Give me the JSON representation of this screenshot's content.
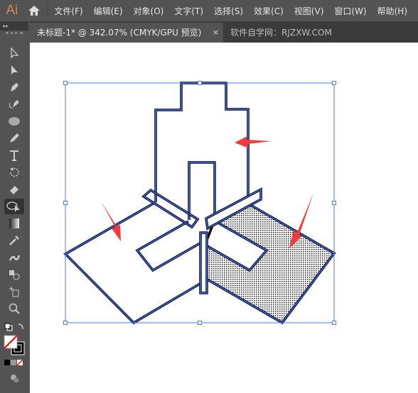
{
  "app": {
    "logo": "Ai",
    "menus": [
      "文件(F)",
      "编辑(E)",
      "对象(O)",
      "文字(T)",
      "选择(S)",
      "效果(C)",
      "视图(V)",
      "窗口(W)",
      "帮助(H)"
    ]
  },
  "tabs": {
    "active": "未标题-1* @ 342.07% (CMYK/GPU 预览)",
    "close": "×",
    "watermark": "软件自学网：RJZXW.COM"
  },
  "toolbar": {
    "collapse": "▸▸",
    "tools": [
      "selection-tool",
      "direct-selection-tool",
      "pen-tool",
      "curvature-tool",
      "ellipse-tool",
      "pencil-tool",
      "type-tool",
      "rotate-tool",
      "eraser-tool",
      "shape-builder-tool",
      "gradient-tool",
      "eyedropper-tool",
      "puppet-warp-tool",
      "blend-tool",
      "artboard-tool",
      "zoom-tool"
    ],
    "active_tool": "shape-builder-tool"
  },
  "colors": {
    "stroke": "#3a5fd0",
    "arrow": "#f23a3a",
    "selection": "#4a7bea",
    "fill_pattern": "#000000"
  }
}
